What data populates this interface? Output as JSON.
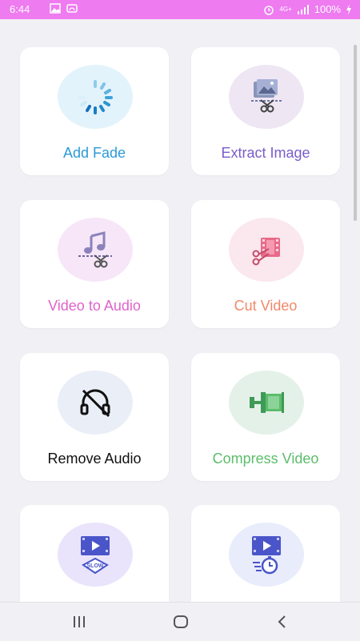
{
  "status_bar": {
    "time": "6:44",
    "battery": "100%",
    "network": "4G+",
    "background": "#ee7bf0"
  },
  "tools": [
    {
      "label": "Add Fade",
      "icon": "fade-spinner-icon",
      "color": "#2b9ad8",
      "circle": "#e3f3fb"
    },
    {
      "label": "Extract Image",
      "icon": "extract-image-icon",
      "color": "#7b5cc9",
      "circle": "#efe6f4"
    },
    {
      "label": "Video to Audio",
      "icon": "video-to-audio-icon",
      "color": "#e063c9",
      "circle": "#f6e6f8"
    },
    {
      "label": "Cut Video",
      "icon": "cut-video-icon",
      "color": "#f0896a",
      "circle": "#fbe7ee"
    },
    {
      "label": "Remove Audio",
      "icon": "remove-audio-icon",
      "color": "#111111",
      "circle": "#eaeff7"
    },
    {
      "label": "Compress Video",
      "icon": "compress-video-icon",
      "color": "#5cbd6a",
      "circle": "#e4f1e9"
    },
    {
      "label": "",
      "icon": "slow-motion-icon",
      "color": "#6b6fd6",
      "circle": "#e9e4fb"
    },
    {
      "label": "",
      "icon": "fast-motion-icon",
      "color": "#6b6fd6",
      "circle": "#e8ecfb"
    }
  ],
  "nav": {
    "recents": "recents-icon",
    "home": "home-icon",
    "back": "back-icon"
  }
}
